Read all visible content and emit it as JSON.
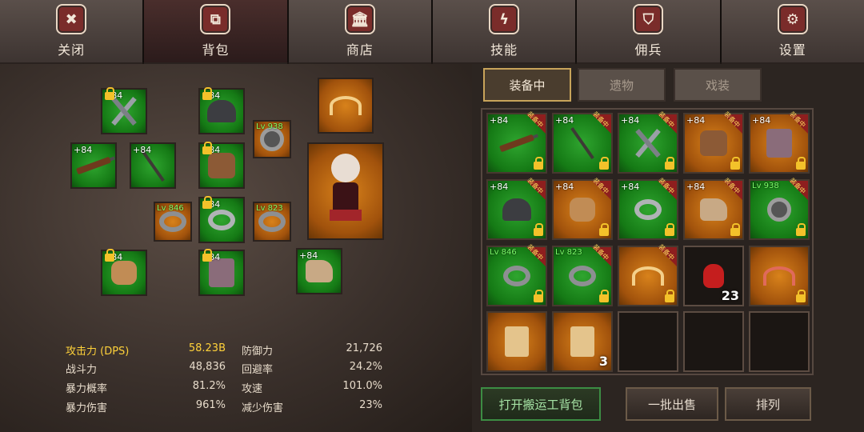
{
  "top_tabs": [
    {
      "label": "关闭",
      "icon": "close-icon",
      "glyph": "✖"
    },
    {
      "label": "背包",
      "icon": "backpack-icon",
      "glyph": "⧉"
    },
    {
      "label": "商店",
      "icon": "shop-icon",
      "glyph": "🏛"
    },
    {
      "label": "技能",
      "icon": "lightning-icon",
      "glyph": "ϟ"
    },
    {
      "label": "佣兵",
      "icon": "shield-icon",
      "glyph": "⛉"
    },
    {
      "label": "设置",
      "icon": "gear-icon",
      "glyph": "⚙"
    }
  ],
  "equipment_slots": [
    {
      "id": "crossed-swords",
      "plus": "+84",
      "rarity": "green"
    },
    {
      "id": "helmet",
      "plus": "+84",
      "rarity": "green"
    },
    {
      "id": "wings",
      "rarity": "orange"
    },
    {
      "id": "amulet",
      "level": "Lv 938",
      "rarity": "orange"
    },
    {
      "id": "rifle",
      "plus": "+84",
      "rarity": "green"
    },
    {
      "id": "staff",
      "plus": "+84",
      "rarity": "green"
    },
    {
      "id": "chest-armor",
      "plus": "+84",
      "rarity": "green"
    },
    {
      "id": "ring-left",
      "level": "Lv 846",
      "rarity": "orange"
    },
    {
      "id": "shoulder",
      "plus": "+84",
      "rarity": "green"
    },
    {
      "id": "ring-right",
      "level": "Lv 823",
      "rarity": "orange"
    },
    {
      "id": "gauntlet",
      "plus": "+84",
      "rarity": "green"
    },
    {
      "id": "pants",
      "plus": "+84",
      "rarity": "green"
    },
    {
      "id": "boots",
      "plus": "+84",
      "rarity": "green"
    }
  ],
  "stats": {
    "left": [
      {
        "label": "攻击力 (DPS)",
        "value": "58.23B",
        "highlight": true
      },
      {
        "label": "战斗力",
        "value": "48,836"
      },
      {
        "label": "暴力概率",
        "value": "81.2%"
      },
      {
        "label": "暴力伤害",
        "value": "961%"
      }
    ],
    "right": [
      {
        "label": "防御力",
        "value": "21,726"
      },
      {
        "label": "回避率",
        "value": "24.2%"
      },
      {
        "label": "攻速",
        "value": "101.0%"
      },
      {
        "label": "减少伤害",
        "value": "23%"
      }
    ]
  },
  "inventory_tabs": [
    "装备中",
    "遗物",
    "戏装"
  ],
  "inventory": [
    {
      "item": "rifle",
      "plus": "+84",
      "rarity": "green",
      "equipped_label": "装备中"
    },
    {
      "item": "staff",
      "plus": "+84",
      "rarity": "green",
      "equipped_label": "装备中"
    },
    {
      "item": "crossed-swords",
      "plus": "+84",
      "rarity": "green",
      "equipped_label": "装备中"
    },
    {
      "item": "chest-armor",
      "plus": "+84",
      "rarity": "orange",
      "equipped_label": "装备中"
    },
    {
      "item": "pants",
      "plus": "+84",
      "rarity": "orange",
      "equipped_label": "装备中"
    },
    {
      "item": "helmet",
      "plus": "+84",
      "rarity": "green",
      "equipped_label": "装备中"
    },
    {
      "item": "gauntlet",
      "plus": "+84",
      "rarity": "orange",
      "equipped_label": "装备中"
    },
    {
      "item": "shoulder",
      "plus": "+84",
      "rarity": "green",
      "equipped_label": "装备中"
    },
    {
      "item": "boots",
      "plus": "+84",
      "rarity": "orange",
      "equipped_label": "装备中"
    },
    {
      "item": "amulet",
      "level": "Lv 938",
      "rarity": "green",
      "equipped_label": "装备中"
    },
    {
      "item": "ring-left",
      "level": "Lv 846",
      "rarity": "green",
      "equipped_label": "装备中"
    },
    {
      "item": "ring-right",
      "level": "Lv 823",
      "rarity": "green",
      "equipped_label": "装备中"
    },
    {
      "item": "wings",
      "rarity": "orange",
      "equipped_label": "装备中"
    },
    {
      "item": "potion",
      "rarity": "dark",
      "count": "23"
    },
    {
      "item": "wings-red",
      "rarity": "orange"
    },
    {
      "item": "scroll",
      "rarity": "orange"
    },
    {
      "item": "scroll",
      "rarity": "orange",
      "count": "3"
    },
    {
      "item": "empty"
    },
    {
      "item": "empty"
    },
    {
      "item": "empty"
    }
  ],
  "buttons": {
    "open_transport": "打开搬运工背包",
    "batch_sell": "一批出售",
    "sort": "排列"
  }
}
